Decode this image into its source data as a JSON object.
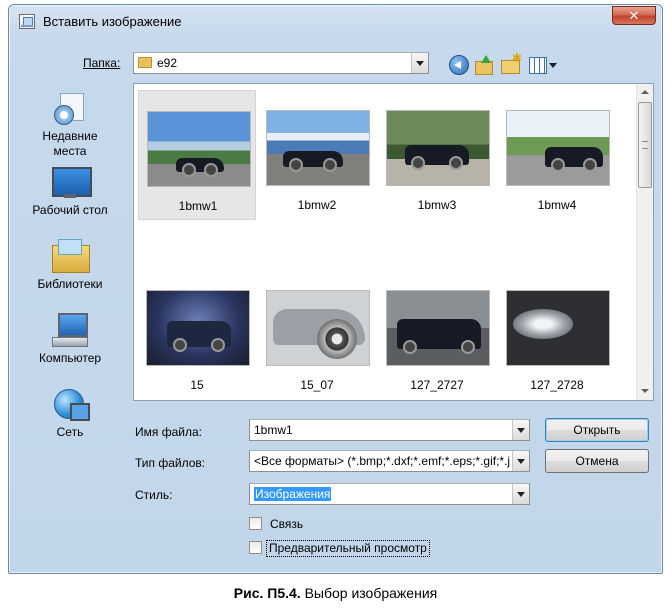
{
  "window": {
    "title": "Вставить изображение",
    "close_glyph": "✕"
  },
  "lookin": {
    "label": "Папка:",
    "value": "e92"
  },
  "toolbar_icons": [
    "back-icon",
    "up-folder-icon",
    "new-folder-icon",
    "views-menu-icon"
  ],
  "places": [
    {
      "id": "recent",
      "label_lines": [
        "Недавние",
        "места"
      ],
      "icon": "recent-places-icon"
    },
    {
      "id": "desktop",
      "label_lines": [
        "Рабочий стол"
      ],
      "icon": "desktop-icon"
    },
    {
      "id": "libraries",
      "label_lines": [
        "Библиотеки"
      ],
      "icon": "libraries-icon"
    },
    {
      "id": "computer",
      "label_lines": [
        "Компьютер"
      ],
      "icon": "computer-icon"
    },
    {
      "id": "network",
      "label_lines": [
        "Сеть"
      ],
      "icon": "network-icon"
    }
  ],
  "files": [
    {
      "name": "1bmw1",
      "selected": true
    },
    {
      "name": "1bmw2",
      "selected": false
    },
    {
      "name": "1bmw3",
      "selected": false
    },
    {
      "name": "1bmw4",
      "selected": false
    },
    {
      "name": "15",
      "selected": false
    },
    {
      "name": "15_07",
      "selected": false
    },
    {
      "name": "127_2727",
      "selected": false
    },
    {
      "name": "127_2728",
      "selected": false
    }
  ],
  "form": {
    "filename_label": "Имя файла:",
    "filename_value": "1bmw1",
    "filetype_label": "Тип файлов:",
    "filetype_value": "<Все форматы> (*.bmp;*.dxf;*.emf;*.eps;*.gif;*.j",
    "style_label": "Стиль:",
    "style_value": "Изображения",
    "link_label": "Связь",
    "preview_label": "Предварительный просмотр"
  },
  "buttons": {
    "open": "Открыть",
    "cancel": "Отмена"
  },
  "caption": {
    "bold": "Рис. П5.4.",
    "text": " Выбор изображения"
  }
}
